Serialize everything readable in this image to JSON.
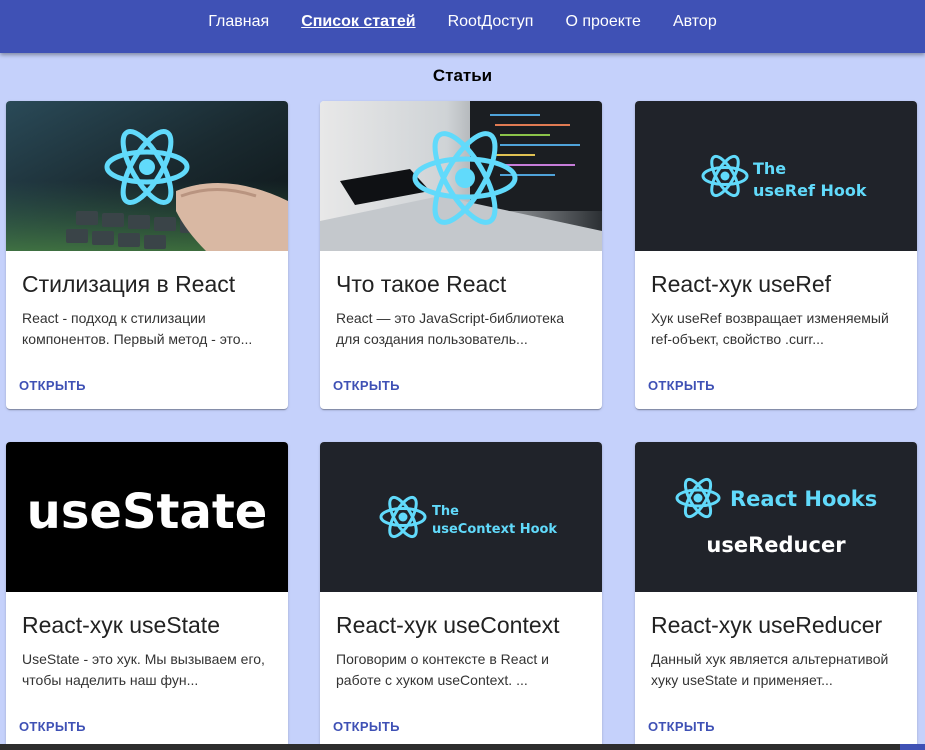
{
  "nav": {
    "items": [
      {
        "label": "Главная",
        "active": false
      },
      {
        "label": "Список статей",
        "active": true
      },
      {
        "label": "RootДоступ",
        "active": false
      },
      {
        "label": "О проекте",
        "active": false
      },
      {
        "label": "Автор",
        "active": false
      }
    ]
  },
  "page": {
    "title": "Статьи"
  },
  "colors": {
    "header": "#3f51b5",
    "background": "#c5d1fb",
    "react_cyan": "#61dafb",
    "dark_thumb": "#20232a"
  },
  "cards": [
    {
      "title": "Стилизация в React",
      "description": "React - подход к стилизации компонентов. Первый метод - это...",
      "action": "ОТКРЫТЬ",
      "image": "react-logo-over-keyboard"
    },
    {
      "title": "Что такое React",
      "description": "React — это JavaScript-библиотека для создания пользователь...",
      "action": "ОТКРЫТЬ",
      "image": "react-logo-over-laptop"
    },
    {
      "title": "React-хук useRef",
      "description": "Хук useRef возвращает изменяемый ref-объект, свойство .curr...",
      "action": "ОТКРЫТЬ",
      "image": "react-logo-the-useref-hook",
      "image_text": [
        "The",
        "useRef Hook"
      ]
    },
    {
      "title": "React-хук useState",
      "description": "UseState - это хук. Мы вызываем его, чтобы наделить наш фун...",
      "action": "ОТКРЫТЬ",
      "image": "usestate-text",
      "image_text": [
        "useState"
      ]
    },
    {
      "title": "React-хук useContext",
      "description": "Поговорим о контексте в React и работе с хуком useContext. ...",
      "action": "ОТКРЫТЬ",
      "image": "react-logo-the-usecontext-hook",
      "image_text": [
        "The",
        "useContext Hook"
      ]
    },
    {
      "title": "React-хук useReducer",
      "description": "Данный хук является альтернативой хуку useState и применяет...",
      "action": "ОТКРЫТЬ",
      "image": "react-hooks-usereducer",
      "image_text": [
        "React Hooks",
        "useReducer"
      ]
    }
  ]
}
